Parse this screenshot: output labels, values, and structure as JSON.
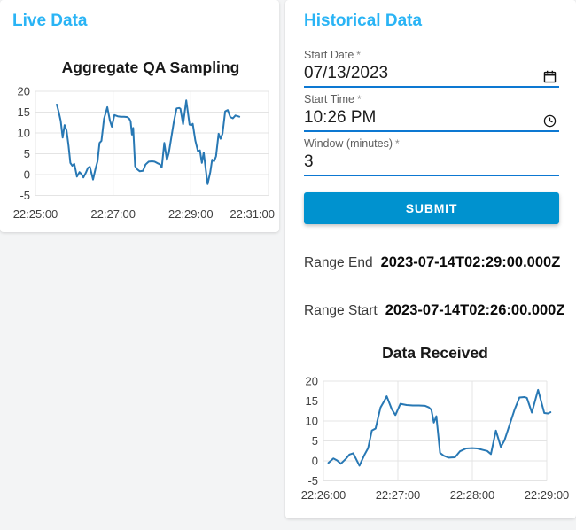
{
  "page_background": "#f3f4f5",
  "accent_colors": {
    "heading_blue": "#2ab4f5",
    "button_blue": "#0092cf",
    "input_underline_blue": "#0d78d2",
    "chart_line_blue": "#2878b4"
  },
  "live_panel": {
    "title": "Live Data"
  },
  "historical_panel": {
    "title": "Historical Data",
    "fields": [
      {
        "label": "Start Date",
        "required": "*",
        "value": "07/13/2023",
        "icon": "calendar-icon"
      },
      {
        "label": "Start Time",
        "required": "*",
        "value": "10:26 PM",
        "icon": "clock-icon"
      },
      {
        "label": "Window (minutes)",
        "required": "*",
        "value": "3",
        "icon": ""
      }
    ],
    "submit_label": "SUBMIT",
    "results": [
      {
        "label": "Range End",
        "value": "2023-07-14T02:29:00.000Z"
      },
      {
        "label": "Range Start",
        "value": "2023-07-14T02:26:00.000Z"
      }
    ]
  },
  "chart_data": [
    {
      "type": "line",
      "title": "Aggregate QA Sampling",
      "x_tick_labels": [
        "22:25:00",
        "22:27:00",
        "22:29:00",
        "22:31:00"
      ],
      "x_tick_seconds": [
        0,
        120,
        240,
        360
      ],
      "x_range_seconds": [
        0,
        360
      ],
      "ylim": [
        -5,
        20
      ],
      "y_ticks": [
        20,
        15,
        10,
        5,
        0,
        -5
      ],
      "grid": true,
      "legend": "none",
      "line_color": "#2878b4",
      "points": [
        [
          33,
          16.8
        ],
        [
          36,
          15.0
        ],
        [
          39,
          12.9
        ],
        [
          42,
          8.9
        ],
        [
          45,
          11.9
        ],
        [
          48,
          10.6
        ],
        [
          51,
          7.0
        ],
        [
          54,
          2.8
        ],
        [
          57,
          2.1
        ],
        [
          60,
          2.6
        ],
        [
          62,
          1.1
        ],
        [
          64,
          -0.5
        ],
        [
          68,
          0.6
        ],
        [
          71,
          0.1
        ],
        [
          74,
          -0.7
        ],
        [
          78,
          0.5
        ],
        [
          81,
          1.6
        ],
        [
          84,
          1.9
        ],
        [
          89,
          -1.2
        ],
        [
          93,
          1.5
        ],
        [
          96,
          3.2
        ],
        [
          99,
          7.6
        ],
        [
          102,
          8.1
        ],
        [
          106,
          13.4
        ],
        [
          109,
          15.0
        ],
        [
          111,
          16.2
        ],
        [
          115,
          13.0
        ],
        [
          118,
          11.5
        ],
        [
          122,
          14.3
        ],
        [
          127,
          14.0
        ],
        [
          132,
          13.9
        ],
        [
          137,
          13.9
        ],
        [
          142,
          13.8
        ],
        [
          145,
          13.4
        ],
        [
          147,
          12.8
        ],
        [
          149,
          9.6
        ],
        [
          151,
          11.2
        ],
        [
          154,
          2.0
        ],
        [
          157,
          1.3
        ],
        [
          161,
          0.8
        ],
        [
          166,
          0.9
        ],
        [
          170,
          2.4
        ],
        [
          175,
          3.1
        ],
        [
          180,
          3.2
        ],
        [
          184,
          3.1
        ],
        [
          189,
          2.7
        ],
        [
          192,
          2.5
        ],
        [
          195,
          1.7
        ],
        [
          199,
          7.6
        ],
        [
          203,
          3.5
        ],
        [
          206,
          5.2
        ],
        [
          210,
          9.0
        ],
        [
          214,
          12.8
        ],
        [
          218,
          15.9
        ],
        [
          222,
          16.0
        ],
        [
          224,
          15.8
        ],
        [
          228,
          12.1
        ],
        [
          233,
          17.8
        ],
        [
          238,
          12.0
        ],
        [
          241,
          11.9
        ],
        [
          243,
          12.2
        ],
        [
          247,
          8.2
        ],
        [
          251,
          5.6
        ],
        [
          254,
          5.8
        ],
        [
          257,
          2.8
        ],
        [
          260,
          5.3
        ],
        [
          263,
          1.4
        ],
        [
          266,
          -2.3
        ],
        [
          270,
          0.6
        ],
        [
          273,
          3.6
        ],
        [
          276,
          3.2
        ],
        [
          279,
          4.4
        ],
        [
          283,
          9.8
        ],
        [
          286,
          8.6
        ],
        [
          289,
          9.8
        ],
        [
          293,
          15.2
        ],
        [
          297,
          15.5
        ],
        [
          301,
          13.8
        ],
        [
          305,
          13.5
        ],
        [
          309,
          14.2
        ],
        [
          315,
          13.9
        ]
      ]
    },
    {
      "type": "line",
      "title": "Data Received",
      "x_tick_labels": [
        "22:26:00",
        "22:27:00",
        "22:28:00",
        "22:29:00"
      ],
      "x_tick_seconds": [
        0,
        60,
        120,
        180
      ],
      "x_range_seconds": [
        0,
        180
      ],
      "ylim": [
        -5,
        20
      ],
      "y_ticks": [
        20,
        15,
        10,
        5,
        0,
        -5
      ],
      "grid": true,
      "legend": "none",
      "line_color": "#2878b4",
      "points": [
        [
          4,
          -0.5
        ],
        [
          8,
          0.6
        ],
        [
          11,
          0.1
        ],
        [
          14,
          -0.7
        ],
        [
          18,
          0.5
        ],
        [
          21,
          1.6
        ],
        [
          24,
          1.9
        ],
        [
          29,
          -1.2
        ],
        [
          33,
          1.5
        ],
        [
          36,
          3.2
        ],
        [
          39,
          7.6
        ],
        [
          42,
          8.1
        ],
        [
          46,
          13.4
        ],
        [
          49,
          15.0
        ],
        [
          51,
          16.2
        ],
        [
          55,
          13.0
        ],
        [
          58,
          11.5
        ],
        [
          62,
          14.3
        ],
        [
          67,
          14.0
        ],
        [
          72,
          13.9
        ],
        [
          77,
          13.9
        ],
        [
          82,
          13.8
        ],
        [
          85,
          13.4
        ],
        [
          87,
          12.8
        ],
        [
          89,
          9.6
        ],
        [
          91,
          11.2
        ],
        [
          94,
          2.0
        ],
        [
          97,
          1.3
        ],
        [
          101,
          0.8
        ],
        [
          106,
          0.9
        ],
        [
          110,
          2.4
        ],
        [
          115,
          3.1
        ],
        [
          120,
          3.2
        ],
        [
          124,
          3.1
        ],
        [
          129,
          2.7
        ],
        [
          132,
          2.5
        ],
        [
          135,
          1.7
        ],
        [
          139,
          7.6
        ],
        [
          143,
          3.5
        ],
        [
          146,
          5.2
        ],
        [
          150,
          9.0
        ],
        [
          154,
          12.8
        ],
        [
          158,
          15.9
        ],
        [
          162,
          16.0
        ],
        [
          164,
          15.8
        ],
        [
          168,
          12.1
        ],
        [
          173,
          17.8
        ],
        [
          178,
          12.0
        ],
        [
          181,
          11.9
        ],
        [
          183,
          12.2
        ]
      ]
    }
  ]
}
